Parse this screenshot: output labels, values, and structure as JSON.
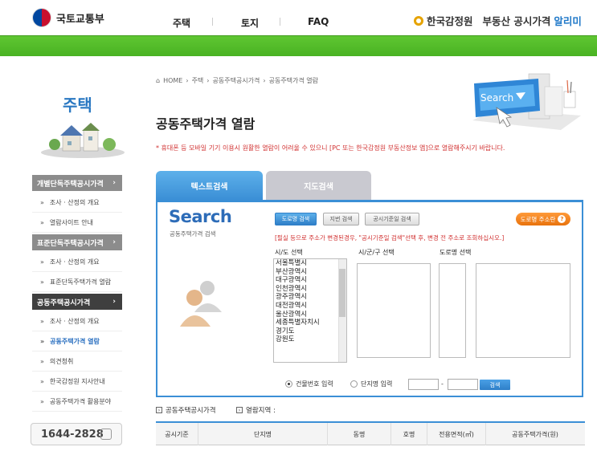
{
  "header": {
    "ministry": "국토교통부",
    "nav": [
      "주택",
      "토지",
      "FAQ"
    ],
    "agency": "한국감정원",
    "service_name": "부동산 공시가격",
    "service_highlight": "알리미"
  },
  "sidebar": {
    "title": "주택",
    "groups": [
      {
        "label": "개별단독주택공시가격",
        "items": [
          "조사 · 산정의 개요",
          "열람사이트 안내"
        ]
      },
      {
        "label": "표준단독주택공시가격",
        "items": [
          "조사 · 산정의 개요",
          "표준단독주택가격 열람"
        ]
      },
      {
        "label": "공동주택공시가격",
        "items": [
          "조사 · 산정의 개요",
          "공동주택가격 열람",
          "의견청취",
          "한국감정원 지사안내",
          "공동주택가격 활용분야"
        ]
      }
    ],
    "phone": "1644-2828"
  },
  "breadcrumb": [
    "HOME",
    "주택",
    "공동주택공시가격",
    "공동주택가격 열람"
  ],
  "page_title": "공동주택가격 열람",
  "notice": "* 휴대폰 등 모바일 기기 이용시 원활한 열람이 어려울 수 있으니 [PC 또는 한국감정원 부동산정보 앱]으로 열람해주시기 바랍니다.",
  "banner_text": "Search",
  "tabs": {
    "text_search": "텍스트검색",
    "map_search": "지도검색"
  },
  "search": {
    "title": "Search",
    "subtitle": "공동주택가격 검색",
    "buttons": [
      "도로명 검색",
      "지번 검색",
      "공시기준일 검색"
    ],
    "road_help": "도로명 주소란",
    "warning": "[필실 등으로 주소가 변경된경우, \"공시기준일 검색\"선택 후, 변경 전 주소로 조회하십시오.]",
    "labels": {
      "sido": "시/도 선택",
      "sigungu": "시/군/구 선택",
      "road": "도로명 선택"
    },
    "sido_list": [
      "서울특별시",
      "부산광역시",
      "대구광역시",
      "인천광역시",
      "광주광역시",
      "대전광역시",
      "울산광역시",
      "세종특별자치시",
      "경기도",
      "강원도"
    ],
    "radio": {
      "building_no": "건물번호 입력",
      "complex_name": "단지명 입력"
    },
    "dash": "-",
    "go": "검색"
  },
  "sections": {
    "price": "공동주택공시가격",
    "area": "열람지역 :"
  },
  "table_headers": [
    "공시기준",
    "단지명",
    "동명",
    "호명",
    "전용면적(㎡)",
    "공동주택가격(원)"
  ],
  "colors": {
    "accent": "#3b8fd6",
    "green_bar": "#5fc632",
    "warning": "#d13030"
  }
}
